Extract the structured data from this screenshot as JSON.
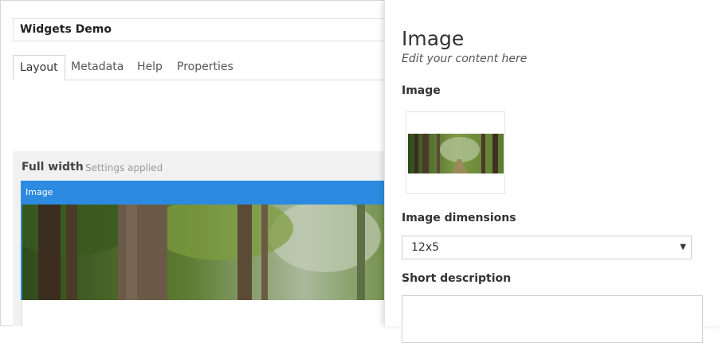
{
  "editor": {
    "page_title": "Widgets Demo",
    "tabs": [
      {
        "label": "Layout",
        "active": true
      },
      {
        "label": "Metadata",
        "active": false
      },
      {
        "label": "Help",
        "active": false
      },
      {
        "label": "Properties",
        "active": false
      }
    ],
    "section": {
      "title": "Full width",
      "note": "Settings applied",
      "widget_label": "Image"
    }
  },
  "panel": {
    "title": "Image",
    "subtitle": "Edit your content here",
    "image_label": "Image",
    "dimensions_label": "Image dimensions",
    "dimensions_value": "12x5",
    "description_label": "Short description",
    "description_value": ""
  },
  "colors": {
    "accent": "#2c8be0",
    "section_bg": "#f1f1f1"
  },
  "icons": {
    "select_arrow": "caret-down-icon"
  }
}
